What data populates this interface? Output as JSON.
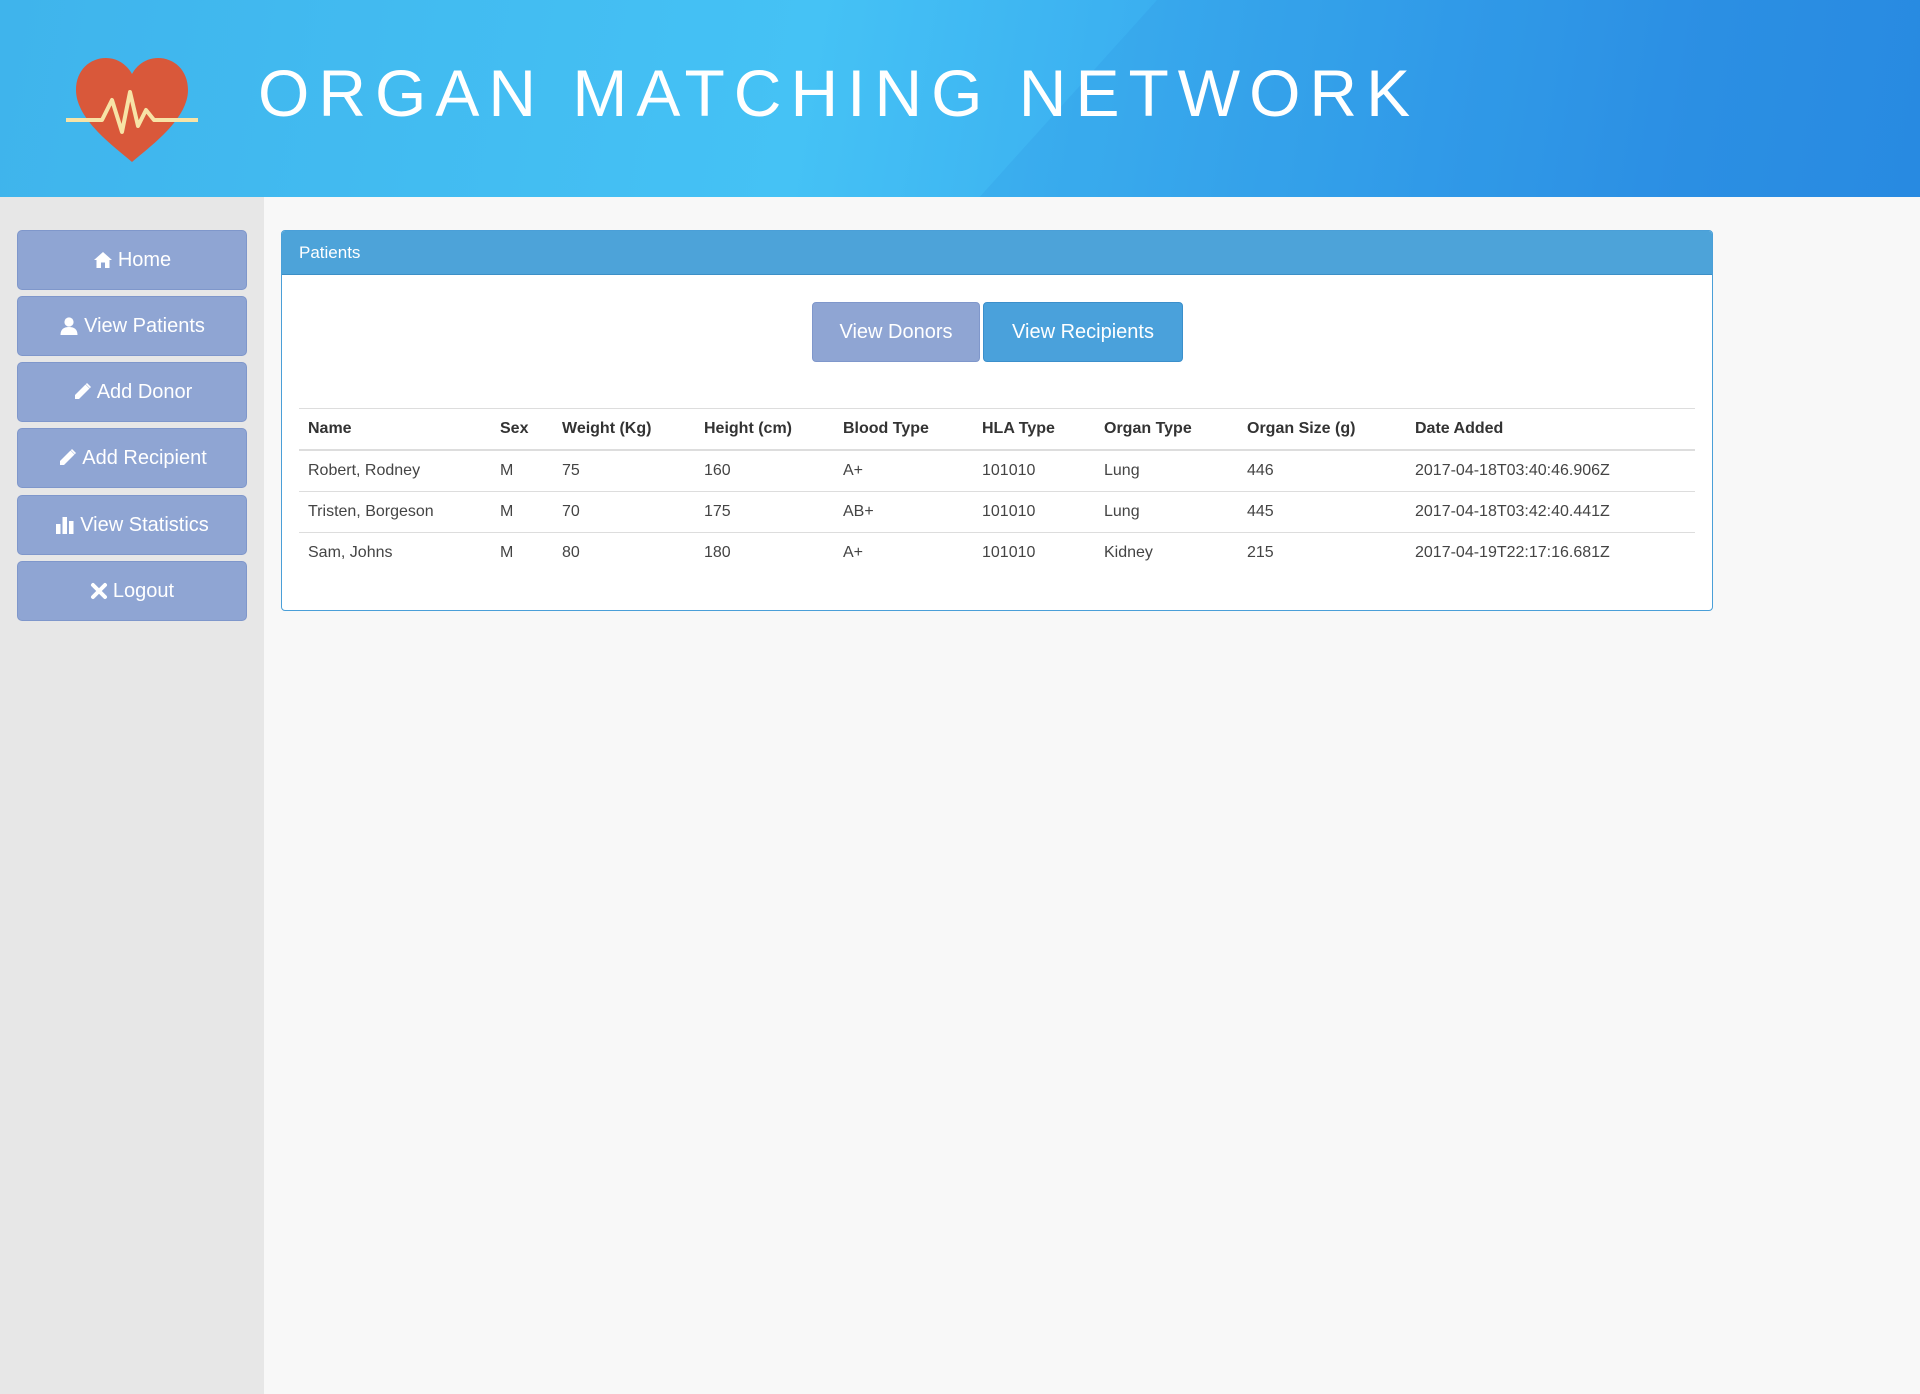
{
  "header": {
    "title": "ORGAN MATCHING NETWORK",
    "logo_icon": "heart-pulse-icon",
    "logo_color": "#d9583a"
  },
  "sidebar": {
    "items": [
      {
        "label": "Home",
        "icon": "home-icon"
      },
      {
        "label": "View Patients",
        "icon": "user-icon"
      },
      {
        "label": "Add Donor",
        "icon": "pencil-icon"
      },
      {
        "label": "Add Recipient",
        "icon": "pencil-icon"
      },
      {
        "label": "View Statistics",
        "icon": "bar-chart-icon"
      },
      {
        "label": "Logout",
        "icon": "close-icon"
      }
    ]
  },
  "panel": {
    "title": "Patients",
    "toggle_donors": "View Donors",
    "toggle_recipients": "View Recipients",
    "active_toggle": "View Recipients"
  },
  "table": {
    "headers": [
      "Name",
      "Sex",
      "Weight (Kg)",
      "Height (cm)",
      "Blood Type",
      "HLA Type",
      "Organ Type",
      "Organ Size (g)",
      "Date Added"
    ],
    "rows": [
      [
        "Robert, Rodney",
        "M",
        "75",
        "160",
        "A+",
        "101010",
        "Lung",
        "446",
        "2017-04-18T03:40:46.906Z"
      ],
      [
        "Tristen, Borgeson",
        "M",
        "70",
        "175",
        "AB+",
        "101010",
        "Lung",
        "445",
        "2017-04-18T03:42:40.441Z"
      ],
      [
        "Sam, Johns",
        "M",
        "80",
        "180",
        "A+",
        "101010",
        "Kidney",
        "215",
        "2017-04-19T22:17:16.681Z"
      ]
    ]
  },
  "colors": {
    "header_start": "#3fb4ec",
    "header_end": "#2a8ee4",
    "nav_button": "#8fa5d3",
    "primary": "#4da3d9"
  }
}
